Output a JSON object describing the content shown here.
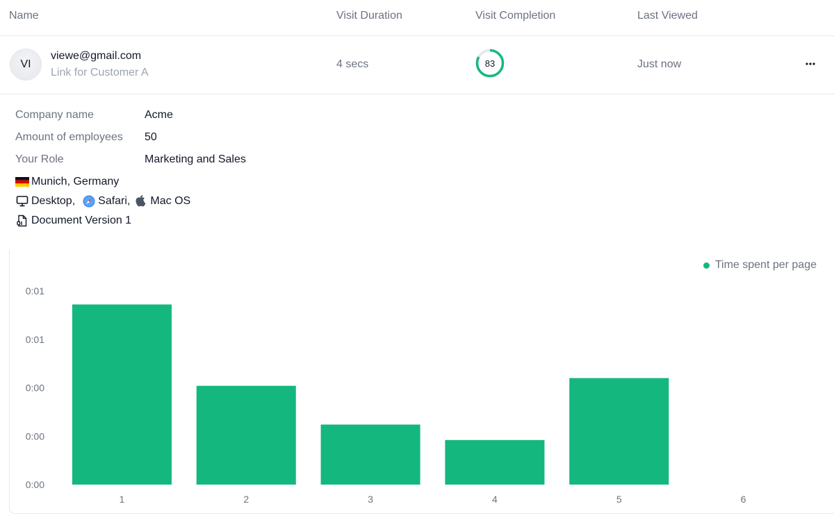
{
  "table": {
    "headers": {
      "name": "Name",
      "visit_duration": "Visit Duration",
      "visit_completion": "Visit Completion",
      "last_viewed": "Last Viewed"
    },
    "row": {
      "avatar_initials": "VI",
      "email": "viewe@gmail.com",
      "link_name": "Link for Customer A",
      "visit_duration": "4 secs",
      "visit_completion": "83",
      "visit_completion_percent": 83,
      "last_viewed": "Just now",
      "more_icon": "ellipsis-icon"
    }
  },
  "details": {
    "fields": [
      {
        "label": "Company name",
        "value": "Acme"
      },
      {
        "label": "Amount of employees",
        "value": "50"
      },
      {
        "label": "Your Role",
        "value": "Marketing and Sales"
      }
    ],
    "location": {
      "icon": "germany-flag-icon",
      "text": "Munich, Germany"
    },
    "device": {
      "icon": "monitor-icon",
      "text": "Desktop,"
    },
    "browser": {
      "icon": "safari-icon",
      "text": "Safari,"
    },
    "os": {
      "icon": "apple-icon",
      "text": "Mac OS"
    },
    "document": {
      "icon": "document-binary-icon",
      "text": "Document Version 1"
    }
  },
  "colors": {
    "accent": "#14b87f",
    "track": "#e5e7eb",
    "muted_text": "#6b7280"
  },
  "chart_data": {
    "type": "bar",
    "title": "",
    "legend": [
      {
        "name": "Time spent per page",
        "color": "#14b87f"
      }
    ],
    "legend_position": "top-right",
    "xlabel": "",
    "ylabel": "",
    "categories": [
      "1",
      "2",
      "3",
      "4",
      "5",
      "6"
    ],
    "series": [
      {
        "name": "Time spent per page",
        "unit": "seconds",
        "values_are_estimates": true,
        "values": [
          0.93,
          0.51,
          0.31,
          0.23,
          0.55,
          0
        ]
      }
    ],
    "ylim": [
      0,
      1.0
    ],
    "yticks": [
      0,
      0.25,
      0.5,
      0.75,
      1.0
    ],
    "ytick_labels": [
      "0:00",
      "0:00",
      "0:00",
      "0:01",
      "0:01"
    ],
    "grid": false
  }
}
